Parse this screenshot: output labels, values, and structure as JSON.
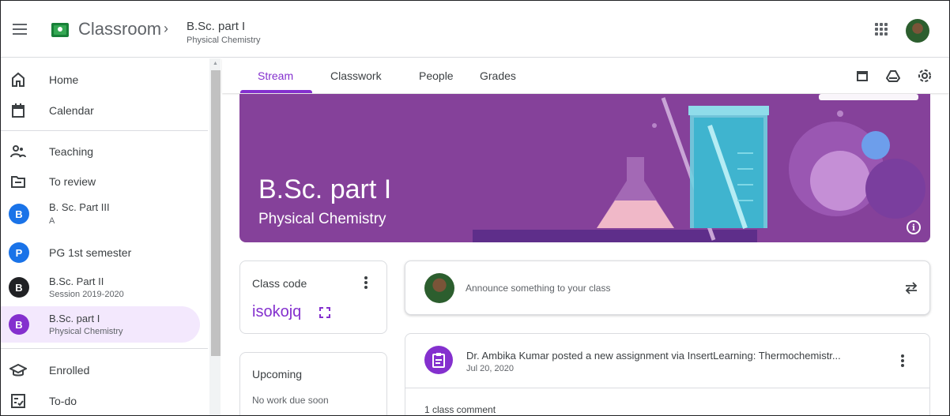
{
  "header": {
    "app_title": "Classroom",
    "breadcrumb_separator": "›",
    "class_title": "B.Sc. part I",
    "class_subtitle": "Physical Chemistry"
  },
  "sidebar": {
    "items": [
      {
        "label": "Home",
        "icon": "home-icon"
      },
      {
        "label": "Calendar",
        "icon": "calendar-icon"
      },
      {
        "label": "Teaching",
        "icon": "people-icon"
      },
      {
        "label": "To review",
        "icon": "folder-icon"
      },
      {
        "label": "B. Sc. Part III",
        "sub": "A",
        "initial": "B",
        "color": "#1a73e8"
      },
      {
        "label": "PG 1st semester",
        "sub": "",
        "initial": "P",
        "color": "#1a73e8"
      },
      {
        "label": "B.Sc. Part II",
        "sub": "Session 2019-2020",
        "initial": "B",
        "color": "#202124"
      },
      {
        "label": "B.Sc. part I",
        "sub": "Physical Chemistry",
        "initial": "B",
        "color": "#8430ce"
      },
      {
        "label": "Enrolled",
        "icon": "graduation-cap-icon"
      },
      {
        "label": "To-do",
        "icon": "todo-icon"
      }
    ]
  },
  "tabs": [
    "Stream",
    "Classwork",
    "People",
    "Grades"
  ],
  "banner": {
    "title": "B.Sc. part I",
    "subtitle": "Physical Chemistry",
    "color": "#85419a"
  },
  "class_code": {
    "label": "Class code",
    "code": "isokojq"
  },
  "upcoming": {
    "title": "Upcoming",
    "empty_text": "No work due soon"
  },
  "announce": {
    "placeholder": "Announce something to your class"
  },
  "post": {
    "text": "Dr. Ambika Kumar posted a new assignment via InsertLearning: Thermochemistr...",
    "date": "Jul 20, 2020",
    "comments": "1 class comment"
  },
  "colors": {
    "accent": "#8430ce",
    "active_bg": "#f3e8fd"
  }
}
